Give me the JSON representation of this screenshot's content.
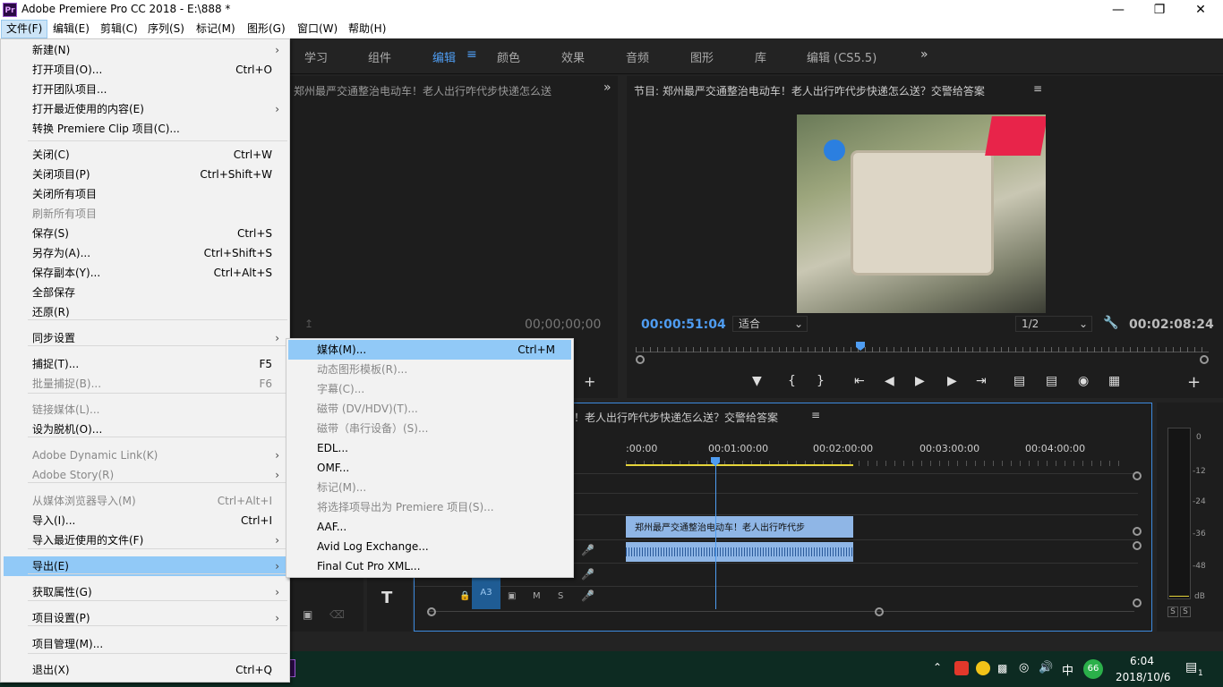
{
  "window": {
    "title": "Adobe Premiere Pro CC 2018 - E:\\888 *",
    "logo": "Pr",
    "minimize_icon": "minimize-icon",
    "maximize_icon": "restore-icon",
    "close_icon": "close-icon"
  },
  "menubar": [
    {
      "label": "文件(F)"
    },
    {
      "label": "编辑(E)"
    },
    {
      "label": "剪辑(C)"
    },
    {
      "label": "序列(S)"
    },
    {
      "label": "标记(M)"
    },
    {
      "label": "图形(G)"
    },
    {
      "label": "窗口(W)"
    },
    {
      "label": "帮助(H)"
    }
  ],
  "workspaces": [
    "学习",
    "组件",
    "编辑",
    "颜色",
    "效果",
    "音频",
    "图形",
    "库",
    "编辑 (CS5.5)"
  ],
  "workspace_selected": "编辑",
  "source": {
    "title": "郑州最严交通整治电动车！老人出行咋代步快递怎么送",
    "timecode": "00;00;00;00"
  },
  "program": {
    "title": "节目: 郑州最严交通整治电动车！老人出行咋代步快递怎么送？交警给答案",
    "timecode": "00:00:51:04",
    "fit": "适合",
    "quality": "1/2",
    "duration": "00:02:08:24"
  },
  "timeline": {
    "title": "！老人出行咋代步快递怎么送？交警给答案",
    "ruler": [
      ":00:00",
      "00:01:00:00",
      "00:02:00:00",
      "00:03:00:00",
      "00:04:00:00"
    ],
    "clip_label": "郑州最严交通整治电动车！老人出行咋代步",
    "track_a3": "A3",
    "m": "M",
    "s": "S"
  },
  "meter": {
    "labels": [
      "0",
      "-12",
      "-24",
      "-36",
      "-48",
      "dB"
    ],
    "solo": [
      "S",
      "S"
    ]
  },
  "file_menu": [
    {
      "label": "新建(N)",
      "sc": "",
      "arrow": true,
      "dis": false
    },
    {
      "label": "打开项目(O)...",
      "sc": "Ctrl+O",
      "dis": false
    },
    {
      "label": "打开团队项目...",
      "sc": "",
      "dis": false
    },
    {
      "label": "打开最近使用的内容(E)",
      "sc": "",
      "arrow": true,
      "dis": false
    },
    {
      "label": "转换 Premiere Clip 项目(C)...",
      "sc": "",
      "dis": false
    },
    {
      "label": "关闭(C)",
      "sc": "Ctrl+W",
      "dis": false
    },
    {
      "label": "关闭项目(P)",
      "sc": "Ctrl+Shift+W",
      "dis": false
    },
    {
      "label": "关闭所有项目",
      "sc": "",
      "dis": false
    },
    {
      "label": "刷新所有项目",
      "sc": "",
      "dis": true
    },
    {
      "label": "保存(S)",
      "sc": "Ctrl+S",
      "dis": false
    },
    {
      "label": "另存为(A)...",
      "sc": "Ctrl+Shift+S",
      "dis": false
    },
    {
      "label": "保存副本(Y)...",
      "sc": "Ctrl+Alt+S",
      "dis": false
    },
    {
      "label": "全部保存",
      "sc": "",
      "dis": false
    },
    {
      "label": "还原(R)",
      "sc": "",
      "dis": false
    },
    {
      "label": "同步设置",
      "sc": "",
      "arrow": true,
      "dis": false
    },
    {
      "label": "捕捉(T)...",
      "sc": "F5",
      "dis": false
    },
    {
      "label": "批量捕捉(B)...",
      "sc": "F6",
      "dis": true
    },
    {
      "label": "链接媒体(L)...",
      "sc": "",
      "dis": true
    },
    {
      "label": "设为脱机(O)...",
      "sc": "",
      "dis": false
    },
    {
      "label": "Adobe Dynamic Link(K)",
      "sc": "",
      "arrow": true,
      "dis": true
    },
    {
      "label": "Adobe Story(R)",
      "sc": "",
      "arrow": true,
      "dis": true
    },
    {
      "label": "从媒体浏览器导入(M)",
      "sc": "Ctrl+Alt+I",
      "dis": true
    },
    {
      "label": "导入(I)...",
      "sc": "Ctrl+I",
      "dis": false
    },
    {
      "label": "导入最近使用的文件(F)",
      "sc": "",
      "arrow": true,
      "dis": false
    },
    {
      "label": "导出(E)",
      "sc": "",
      "arrow": true,
      "dis": false,
      "hl": true
    },
    {
      "label": "获取属性(G)",
      "sc": "",
      "arrow": true,
      "dis": false
    },
    {
      "label": "项目设置(P)",
      "sc": "",
      "arrow": true,
      "dis": false
    },
    {
      "label": "项目管理(M)...",
      "sc": "",
      "dis": false
    },
    {
      "label": "退出(X)",
      "sc": "Ctrl+Q",
      "dis": false
    }
  ],
  "export_menu": [
    {
      "label": "媒体(M)...",
      "sc": "Ctrl+M",
      "dis": false,
      "hl": true
    },
    {
      "label": "动态图形模板(R)...",
      "sc": "",
      "dis": true
    },
    {
      "label": "字幕(C)...",
      "sc": "",
      "dis": true
    },
    {
      "label": "磁带 (DV/HDV)(T)...",
      "sc": "",
      "dis": true
    },
    {
      "label": "磁带（串行设备）(S)...",
      "sc": "",
      "dis": true
    },
    {
      "label": "EDL...",
      "sc": "",
      "dis": false
    },
    {
      "label": "OMF...",
      "sc": "",
      "dis": false
    },
    {
      "label": "标记(M)...",
      "sc": "",
      "dis": true
    },
    {
      "label": "将选择项导出为 Premiere 项目(S)...",
      "sc": "",
      "dis": true
    },
    {
      "label": "AAF...",
      "sc": "",
      "dis": false
    },
    {
      "label": "Avid Log Exchange...",
      "sc": "",
      "dis": false
    },
    {
      "label": "Final Cut Pro XML...",
      "sc": "",
      "dis": false
    }
  ],
  "tray": {
    "ime": "中",
    "badge": "66",
    "time": "6:04",
    "date": "2018/10/6",
    "notif": "1"
  }
}
